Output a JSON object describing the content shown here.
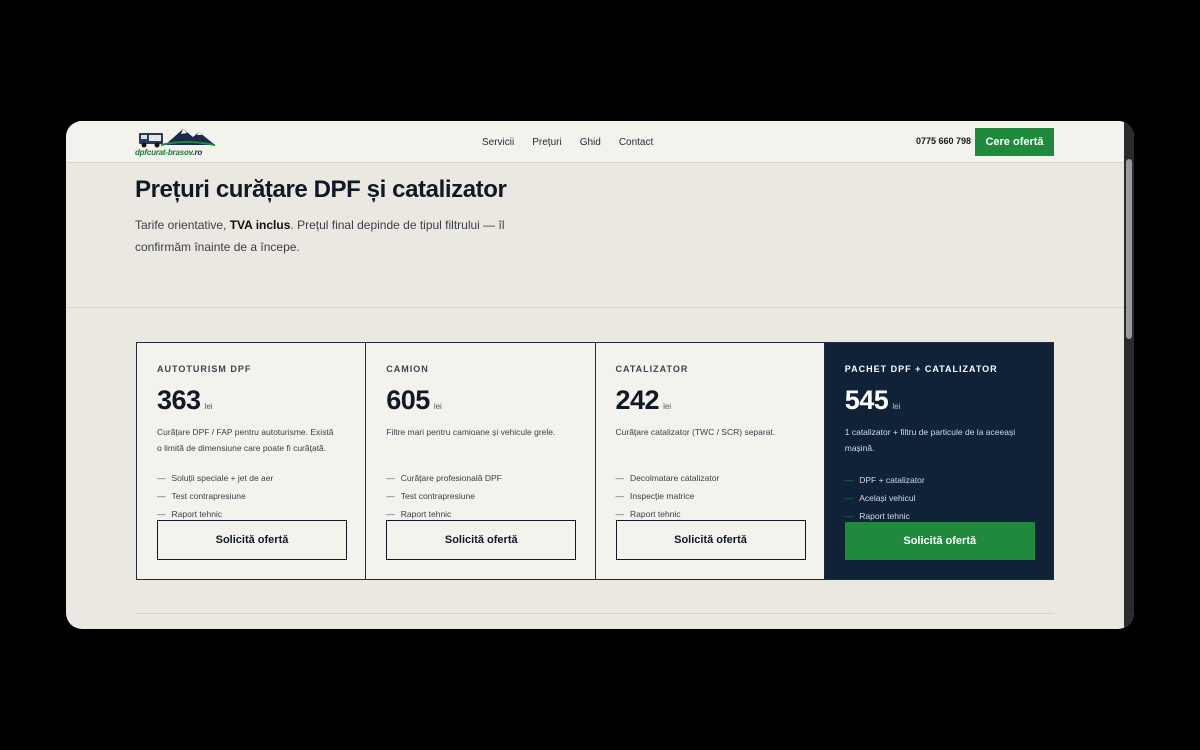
{
  "header": {
    "logo_text": "dpfcurat-brasov",
    "logo_suffix": ".ro",
    "nav": [
      "Servicii",
      "Prețuri",
      "Ghid",
      "Contact"
    ],
    "phone": "0775 660 798",
    "cta_label": "Cere ofertă"
  },
  "hero": {
    "title": "Prețuri curățare DPF și catalizator",
    "intro_before": "Tarife orientative, ",
    "intro_bold": "TVA inclus",
    "intro_after": ". Prețul final depinde de tipul filtrului — îl confirmăm înainte de a începe."
  },
  "cards": [
    {
      "title": "AUTOTURISM DPF",
      "price": "363",
      "unit": "lei",
      "desc": "Curățare DPF / FAP pentru autoturisme. Există o limită de dimensiune care poate fi curățată.",
      "features": [
        "Soluții speciale + jet de aer",
        "Test contrapresiune",
        "Raport tehnic"
      ],
      "button": "Solicită ofertă"
    },
    {
      "title": "CAMION",
      "price": "605",
      "unit": "lei",
      "desc": "Filtre mari pentru camioane și vehicule grele.",
      "features": [
        "Curățare profesională DPF",
        "Test contrapresiune",
        "Raport tehnic"
      ],
      "button": "Solicită ofertă"
    },
    {
      "title": "CATALIZATOR",
      "price": "242",
      "unit": "lei",
      "desc": "Curățare catalizator (TWC / SCR) separat.",
      "features": [
        "Decolmatare catalizator",
        "Inspecție matrice",
        "Raport tehnic"
      ],
      "button": "Solicită ofertă"
    },
    {
      "title": "PACHET DPF + CATALIZATOR",
      "price": "545",
      "unit": "lei",
      "desc": "1 catalizator + filtru de particule de la aceeași mașină.",
      "features": [
        "DPF + catalizator",
        "Același vehicul",
        "Raport tehnic"
      ],
      "button": "Solicită ofertă"
    }
  ],
  "colors": {
    "accent_green": "#1f8a3c",
    "navy": "#0f2238",
    "background": "#ebe8e1"
  },
  "icons": {
    "logo": "truck-mountain-logo-icon"
  }
}
